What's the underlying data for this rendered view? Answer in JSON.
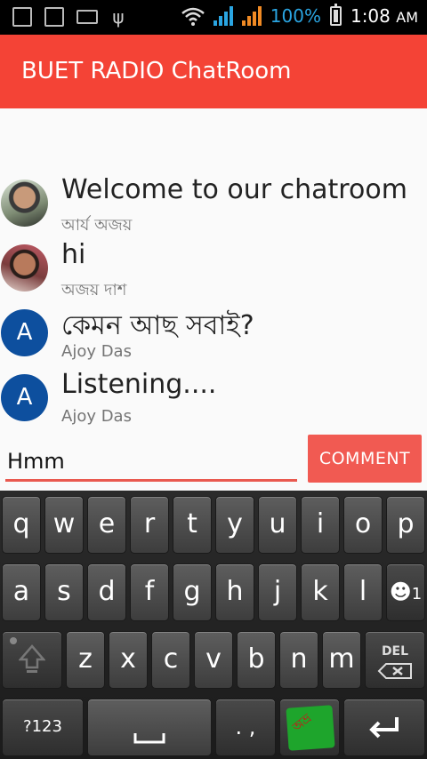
{
  "status_bar": {
    "battery_percent": "100%",
    "time": "1:08",
    "ampm": "AM",
    "battery_color": "#2aa5e2"
  },
  "app_bar": {
    "title": "BUET RADIO ChatRoom",
    "color": "#f44336"
  },
  "messages": [
    {
      "text": "Welcome to our chatroom",
      "author": "আর্য অজয়",
      "avatar": "photo"
    },
    {
      "text": "hi",
      "author": "অজয় দাশ",
      "avatar": "photo"
    },
    {
      "text": "কেমন আছ সবাই?",
      "author": "Ajoy Das",
      "avatar": "A"
    },
    {
      "text": "Listening....",
      "author": "Ajoy Das",
      "avatar": "A"
    }
  ],
  "composer": {
    "input_value": "Hmm",
    "button_label": "COMMENT",
    "accent": "#f15a52"
  },
  "keyboard": {
    "row1": [
      "q",
      "w",
      "e",
      "r",
      "t",
      "y",
      "u",
      "i",
      "o",
      "p"
    ],
    "row2": [
      "a",
      "s",
      "d",
      "f",
      "g",
      "h",
      "j",
      "k",
      "l"
    ],
    "row3": [
      "z",
      "x",
      "c",
      "v",
      "b",
      "n",
      "m"
    ],
    "emoji_key_label": "1",
    "del_label": "DEL",
    "symbols_label": "?123",
    "punct_label": ". ,",
    "bangla_logo_text": "অভ্র"
  }
}
